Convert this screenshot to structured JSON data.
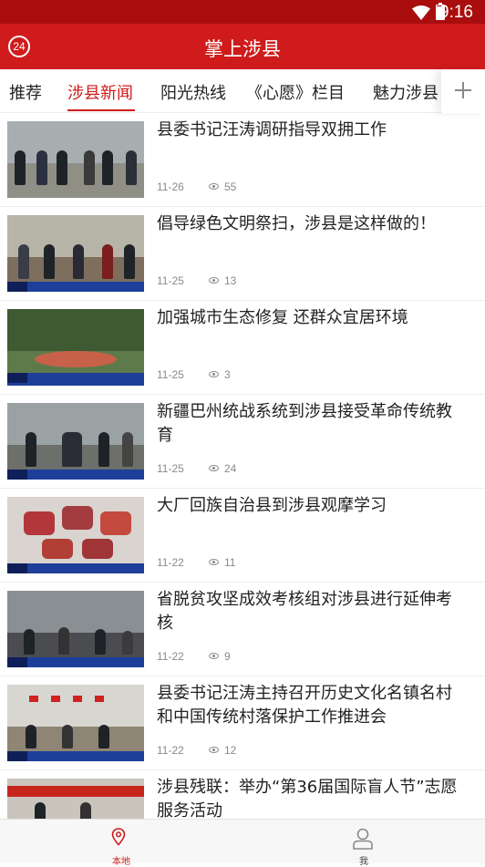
{
  "status_bar": {
    "time": "9:16",
    "battery_level": 0.95
  },
  "app_bar": {
    "badge": "24",
    "title": "掌上涉县"
  },
  "tabs": [
    {
      "label": "推荐",
      "active": false
    },
    {
      "label": "涉县新闻",
      "active": true
    },
    {
      "label": "阳光热线",
      "active": false
    },
    {
      "label": "《心愿》栏目",
      "active": false
    },
    {
      "label": "魅力涉县",
      "active": false
    }
  ],
  "feed": [
    {
      "title": "县委书记汪涛调研指导双拥工作",
      "date": "11-26",
      "views": "55"
    },
    {
      "title": "倡导绿色文明祭扫，涉县是这样做的！",
      "date": "11-25",
      "views": "13"
    },
    {
      "title": "加强城市生态修复 还群众宜居环境",
      "date": "11-25",
      "views": "3"
    },
    {
      "title": "新疆巴州统战系统到涉县接受革命传统教育",
      "date": "11-25",
      "views": "24"
    },
    {
      "title": "大厂回族自治县到涉县观摩学习",
      "date": "11-22",
      "views": "11"
    },
    {
      "title": "省脱贫攻坚成效考核组对涉县进行延伸考核",
      "date": "11-22",
      "views": "9"
    },
    {
      "title": "县委书记汪涛主持召开历史文化名镇名村和中国传统村落保护工作推进会",
      "date": "11-22",
      "views": "12"
    },
    {
      "title": "涉县残联：举办“第36届国际盲人节”志愿服务活动",
      "date": "",
      "views": ""
    }
  ],
  "bottom_nav": [
    {
      "label": "本地",
      "active": true,
      "icon": "location-pin-icon"
    },
    {
      "label": "我",
      "active": false,
      "icon": "user-icon"
    }
  ],
  "colors": {
    "brand_red": "#cf1b1b",
    "status_bar": "#a90d0d",
    "text": "#222222",
    "meta": "#8a8a8a"
  }
}
